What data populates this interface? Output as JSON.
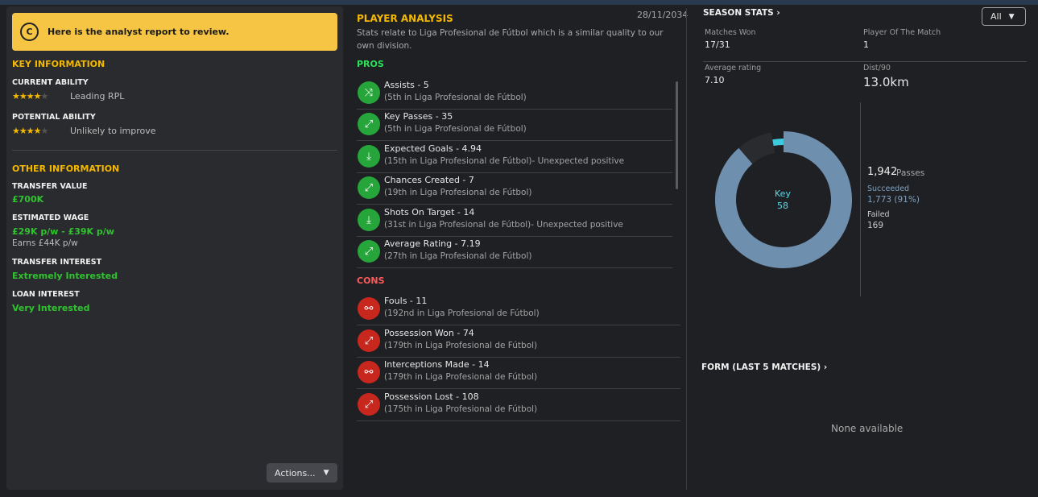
{
  "banner": {
    "badge": "C",
    "text": "Here is the analyst report to review."
  },
  "key_info": {
    "title": "KEY INFORMATION",
    "current_ability": {
      "label": "CURRENT ABILITY",
      "stars": 3.5,
      "max_stars": 5,
      "note": "Leading RPL"
    },
    "potential_ability": {
      "label": "POTENTIAL ABILITY",
      "stars": 3.5,
      "max_stars": 5,
      "note": "Unlikely to improve"
    }
  },
  "other_info": {
    "title": "OTHER INFORMATION",
    "transfer_value": {
      "label": "TRANSFER VALUE",
      "value": "£700K"
    },
    "estimated_wage": {
      "label": "ESTIMATED WAGE",
      "value": "£29K p/w - £39K p/w",
      "sub": "Earns £44K p/w"
    },
    "transfer_interest": {
      "label": "TRANSFER INTEREST",
      "value": "Extremely Interested"
    },
    "loan_interest": {
      "label": "LOAN INTEREST",
      "value": "Very Interested"
    }
  },
  "actions_button": "Actions...",
  "analysis": {
    "title": "PLAYER ANALYSIS",
    "date": "28/11/2034",
    "description": "Stats relate to Liga Profesional de Fútbol which is a similar quality to our own division.",
    "pros_title": "PROS",
    "pros": [
      {
        "main": "Assists - 5",
        "sub": "(5th in Liga Profesional de Fútbol)",
        "icon": "assist-icon"
      },
      {
        "main": "Key Passes - 35",
        "sub": "(5th in Liga Profesional de Fútbol)",
        "icon": "key-pass-icon"
      },
      {
        "main": "Expected Goals - 4.94",
        "sub": "(15th in Liga Profesional de Fútbol)- Unexpected positive",
        "icon": "expected-goals-icon"
      },
      {
        "main": "Chances Created - 7",
        "sub": "(19th in Liga Profesional de Fútbol)",
        "icon": "chances-icon"
      },
      {
        "main": "Shots On Target - 14",
        "sub": "(31st in Liga Profesional de Fútbol)- Unexpected positive",
        "icon": "shot-icon"
      },
      {
        "main": "Average Rating - 7.19",
        "sub": "(27th in Liga Profesional de Fútbol)",
        "icon": "rating-icon"
      }
    ],
    "cons_title": "CONS",
    "cons": [
      {
        "main": "Fouls - 11",
        "sub": "(192nd in Liga Profesional de Fútbol)",
        "icon": "foul-icon"
      },
      {
        "main": "Possession Won - 74",
        "sub": "(179th in Liga Profesional de Fútbol)",
        "icon": "possession-won-icon"
      },
      {
        "main": "Interceptions Made - 14",
        "sub": "(179th in Liga Profesional de Fútbol)",
        "icon": "interception-icon"
      },
      {
        "main": "Possession Lost - 108",
        "sub": "(175th in Liga Profesional de Fútbol)",
        "icon": "possession-lost-icon"
      }
    ]
  },
  "season_stats": {
    "title": "SEASON STATS",
    "filter": "All",
    "matches_won": {
      "label": "Matches Won",
      "value": "17/31"
    },
    "potm": {
      "label": "Player Of The Match",
      "value": "1"
    },
    "avg_rating": {
      "label": "Average rating",
      "value": "7.10"
    },
    "dist": {
      "label": "Dist/90",
      "value": "13.0km"
    },
    "passes": {
      "total": "1,942",
      "label": "Passes",
      "succeeded_label": "Succeeded",
      "succeeded": "1,773 (91%)",
      "failed_label": "Failed",
      "failed": "169",
      "key_label": "Key",
      "key": "58"
    }
  },
  "chart_data": {
    "type": "pie",
    "categories": [
      "Succeeded",
      "Failed",
      "Key"
    ],
    "values": [
      1773,
      169,
      58
    ],
    "colors": {
      "Succeeded": "#6f8faf",
      "Failed": "#2a2b2e",
      "Key": "#3fc9dd"
    }
  },
  "form": {
    "title": "FORM (LAST 5 MATCHES)",
    "empty": "None available"
  },
  "colors": {
    "accent": "#f5b800",
    "positive": "#2fc42f",
    "negative": "#c8271e",
    "banner": "#f6c544"
  }
}
